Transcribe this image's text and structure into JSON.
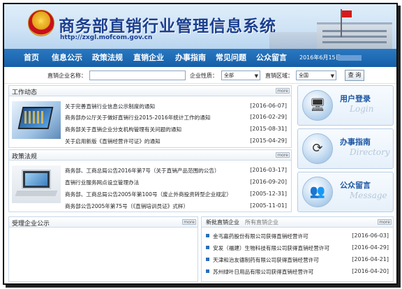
{
  "header": {
    "site_title": "商务部直销行业管理信息系统",
    "site_url": "http://zxgl.mofcom.gov.cn"
  },
  "nav": {
    "items": [
      "首页",
      "信息公示",
      "政策法规",
      "直销企业",
      "办事指南",
      "常见问题",
      "公众留言"
    ],
    "date": "2016年6月15日"
  },
  "search": {
    "company_label": "直销企业名称：",
    "company_value": "",
    "nature_label": "企业性质：",
    "nature_selected": "全部",
    "region_label": "直销区域：",
    "region_selected": "全国",
    "query_button": "查 询"
  },
  "work_news": {
    "title": "工作动态",
    "more": "more",
    "items": [
      {
        "title": "关于完善直销行业信息公示制度的通知",
        "date": "[2016-06-07]"
      },
      {
        "title": "商务部办公厅关于做好直销行业2015-2016年统计工作的通知",
        "date": "[2016-02-29]"
      },
      {
        "title": "商务部关于直销企业分支机构管理有关问题的通知",
        "date": "[2015-08-31]"
      },
      {
        "title": "关于启用新版《直销经营许可证》的通知",
        "date": "[2015-04-29]"
      }
    ]
  },
  "policy": {
    "title": "政策法规",
    "more": "more",
    "items": [
      {
        "title": "商务部、工商总局公告2016年第7号（关于直销产品范围的公告）",
        "date": "[2016-03-17]"
      },
      {
        "title": "直销行业服务网点设立管理办法",
        "date": "[2016-09-20]"
      },
      {
        "title": "商务部、工商总局公告2005年第100号（废止外商投资转型企业规定）",
        "date": "[2005-12-31]"
      },
      {
        "title": "商务部公告2005年第75号（《直销培训员证》式样）",
        "date": "[2005-11-01]"
      }
    ]
  },
  "side": {
    "login": {
      "label": "用户登录",
      "sub": "Login",
      "icon": "login-icon"
    },
    "guide": {
      "label": "办事指南",
      "sub": "Directory",
      "icon": "guide-icon"
    },
    "message": {
      "label": "公众留言",
      "sub": "Message",
      "icon": "message-icon"
    }
  },
  "accepted": {
    "title": "受理企业公示",
    "more": "more"
  },
  "approved": {
    "tab_new": "新批直销企业",
    "tab_all": "所有直销企业",
    "more": "more",
    "items": [
      {
        "title": "金丐嘉药股份有限公司获得直销经营许可",
        "date": "[2016-06-03]"
      },
      {
        "title": "安发（福建）生物科技有限公司获得直销经营许可",
        "date": "[2016-04-29]"
      },
      {
        "title": "天津和治友德制药有限公司获得直销经营许可",
        "date": "[2016-04-21]"
      },
      {
        "title": "苏州绿叶日用品有限公司获得直销经营许可",
        "date": "[2016-04-20]"
      }
    ]
  },
  "colors": {
    "nav": "#1a68b4",
    "title": "#1b3f8f",
    "side_label": "#1b56a3"
  }
}
